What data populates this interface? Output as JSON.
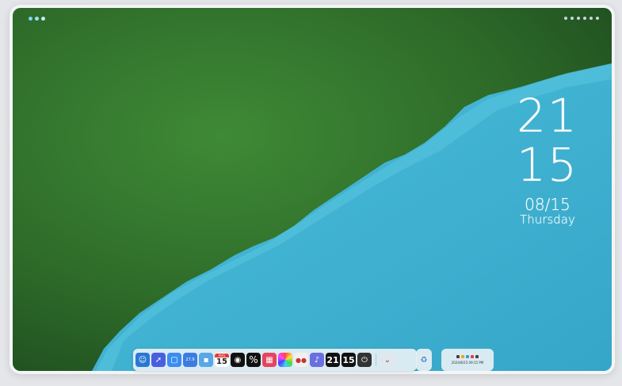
{
  "clock": {
    "hour": "21",
    "minute": "15",
    "date": "08/15",
    "weekday": "Thursday"
  },
  "dock": {
    "calendar": {
      "month": "AUG",
      "day": "15"
    },
    "weather_temp": "27.9",
    "clock_hour": "21",
    "clock_minute": "15",
    "icons": [
      "finder-icon",
      "rocket-icon",
      "window-icon",
      "weather-icon",
      "app-icon",
      "calendar-icon",
      "eyes-icon",
      "percent-icon",
      "grid-icon",
      "color-wheel-icon",
      "control-icon",
      "volume-icon",
      "hour-icon",
      "minute-icon",
      "power-icon",
      "chevron-down-icon",
      "recycle-icon"
    ]
  },
  "status": {
    "datetime": "2024/8/15 09:15 PM"
  },
  "colors": {
    "water": "#3fb0d0",
    "forest": "#2e6b2a"
  }
}
